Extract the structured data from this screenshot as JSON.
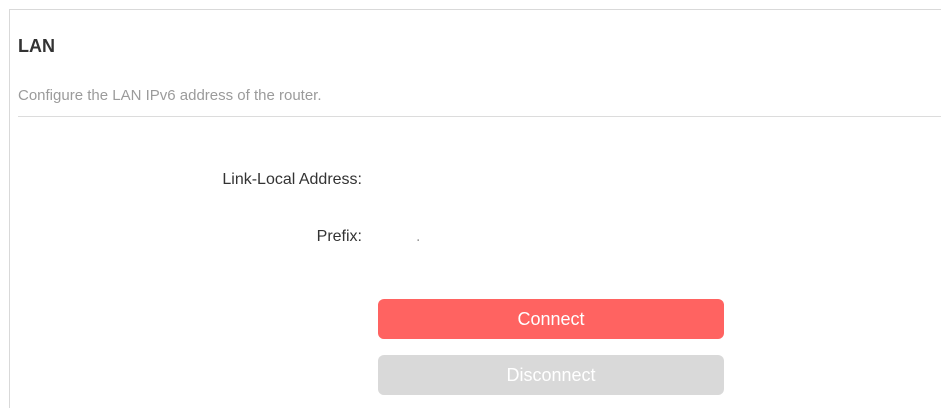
{
  "section": {
    "title": "LAN",
    "description": "Configure the LAN IPv6 address of the router."
  },
  "fields": {
    "link_local_label": "Link-Local Address:",
    "link_local_value": "",
    "prefix_label": "Prefix:",
    "prefix_value": "."
  },
  "buttons": {
    "connect_label": "Connect",
    "disconnect_label": "Disconnect"
  },
  "colors": {
    "connect_bg": "#ff6361",
    "disconnect_bg": "#d9d9d9"
  }
}
